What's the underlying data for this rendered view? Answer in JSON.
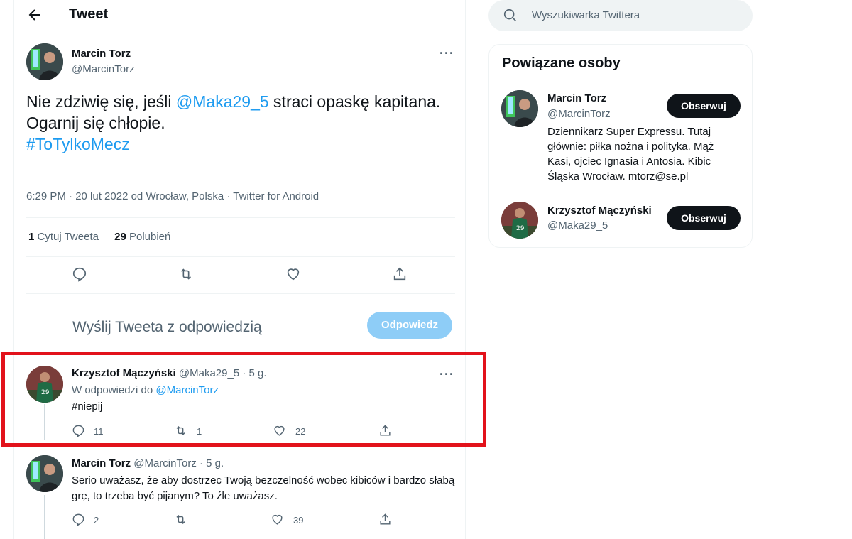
{
  "header": {
    "title": "Tweet"
  },
  "main_tweet": {
    "author_name": "Marcin Torz",
    "author_handle": "@MarcinTorz",
    "text_before": "Nie zdziwię się, jeśli ",
    "mention": "@Maka29_5",
    "text_after": " straci opaskę kapitana.",
    "line2": "Ogarnij się chłopie.",
    "hashtag": "#ToTylkoMecz",
    "meta": "6:29 PM · 20 lut 2022 od Wrocław, Polska · Twitter for Android",
    "quote_count": "1",
    "quote_label": "Cytuj Tweeta",
    "like_count": "29",
    "like_label": "Polubień"
  },
  "reply_box": {
    "placeholder": "Wyślij Tweeta z odpowiedzią",
    "button_label": "Odpowiedz"
  },
  "replies": [
    {
      "author_name": "Krzysztof Mączyński",
      "author_handle": "@Maka29_5",
      "time": "· 5 g.",
      "reply_to_prefix": "W odpowiedzi do ",
      "reply_to_handle": "@MarcinTorz",
      "text": "#niepij",
      "reply_count": "11",
      "retweet_count": "1",
      "like_count": "22"
    },
    {
      "author_name": "Marcin Torz",
      "author_handle": "@MarcinTorz",
      "time": "· 5 g.",
      "text": "Serio uważasz, że aby dostrzec Twoją bezczelność wobec kibiców i bardzo słabą grę, to trzeba być pijanym? To źle uważasz.",
      "reply_count": "2",
      "retweet_count": "",
      "like_count": "39"
    }
  ],
  "search": {
    "placeholder": "Wyszukiwarka Twittera"
  },
  "related": {
    "title": "Powiązane osoby",
    "people": [
      {
        "name": "Marcin Torz",
        "handle": "@MarcinTorz",
        "bio": "Dziennikarz Super Expressu. Tutaj głównie: piłka nożna i polityka. Mąż Kasi, ojciec Ignasia i Antosia. Kibic Śląska Wrocław. mtorz@se.pl",
        "button": "Obserwuj"
      },
      {
        "name": "Krzysztof Mączyński",
        "handle": "@Maka29_5",
        "button": "Obserwuj"
      }
    ]
  },
  "colors": {
    "accent": "#1d9bf0",
    "highlight": "#e2121b",
    "text": "#0f1419",
    "muted": "#536471"
  }
}
